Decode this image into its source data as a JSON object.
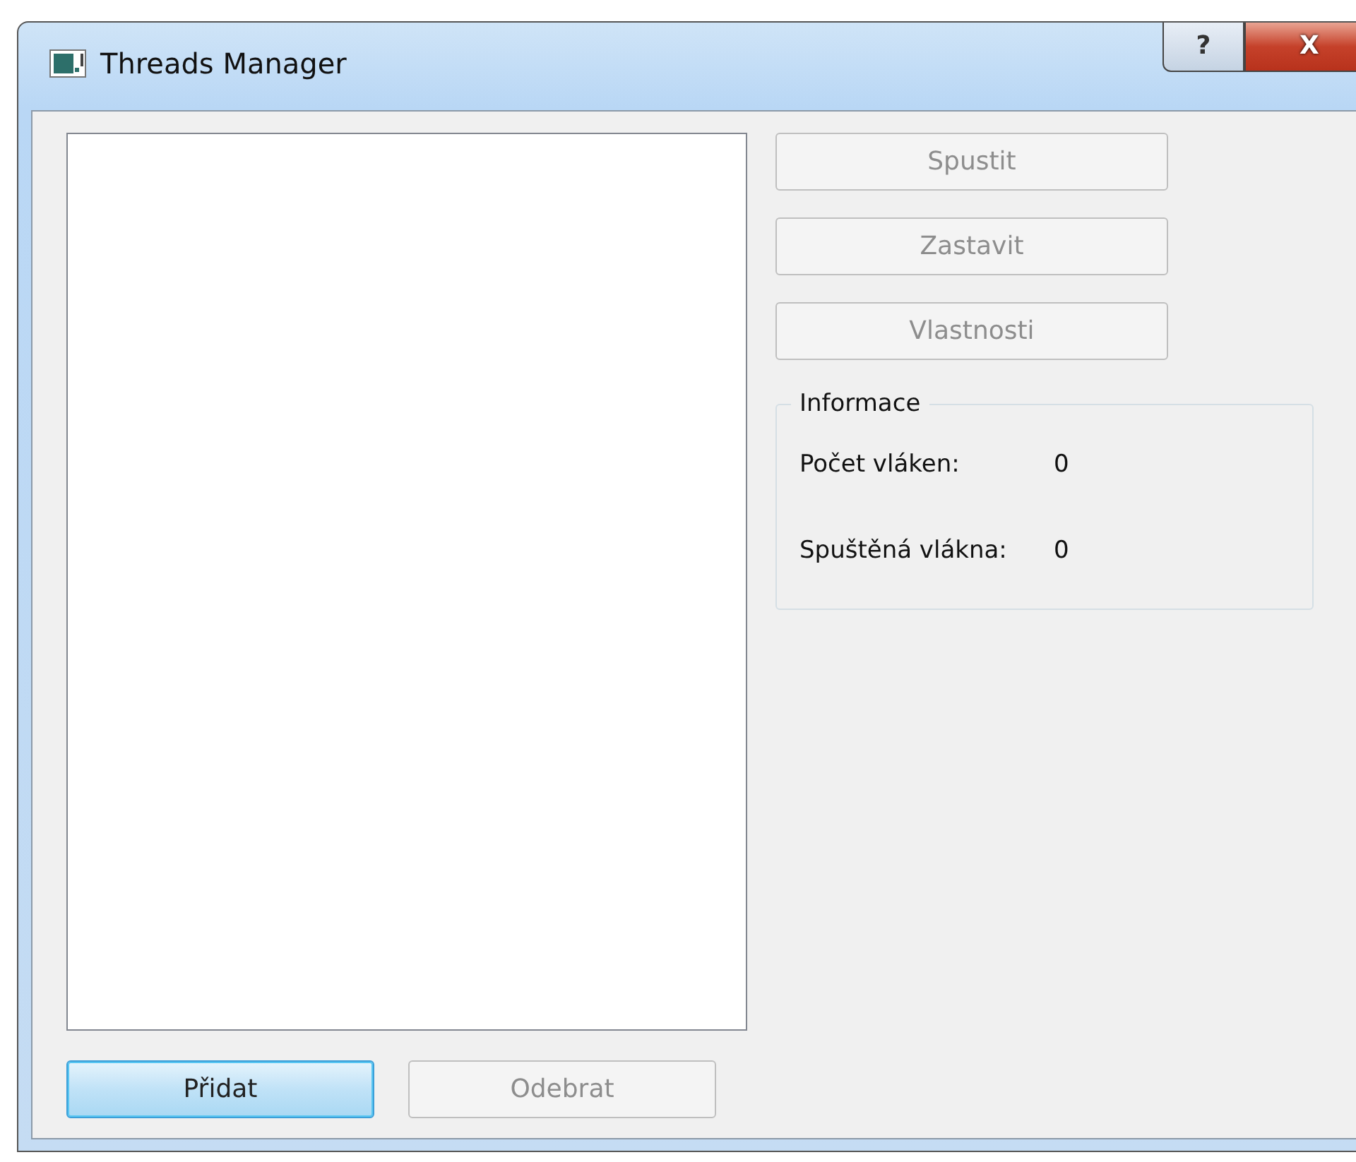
{
  "window": {
    "title": "Threads Manager",
    "title_buttons": [
      {
        "kind": "help",
        "label": "?"
      },
      {
        "kind": "close",
        "label": "X"
      }
    ]
  },
  "action_buttons": [
    {
      "label": "Spustit",
      "disabled": true
    },
    {
      "label": "Zastavit",
      "disabled": true
    },
    {
      "label": "Vlastnosti",
      "disabled": true
    }
  ],
  "info_group": {
    "title": "Informace",
    "rows": [
      {
        "label": "Počet vláken:",
        "value": "0"
      },
      {
        "label": "Spuštěná vlákna:",
        "value": "0"
      }
    ]
  },
  "bottom_buttons": [
    {
      "label": "Přidat",
      "disabled": false,
      "default": true
    },
    {
      "label": "Odebrat",
      "disabled": true,
      "default": false
    }
  ]
}
